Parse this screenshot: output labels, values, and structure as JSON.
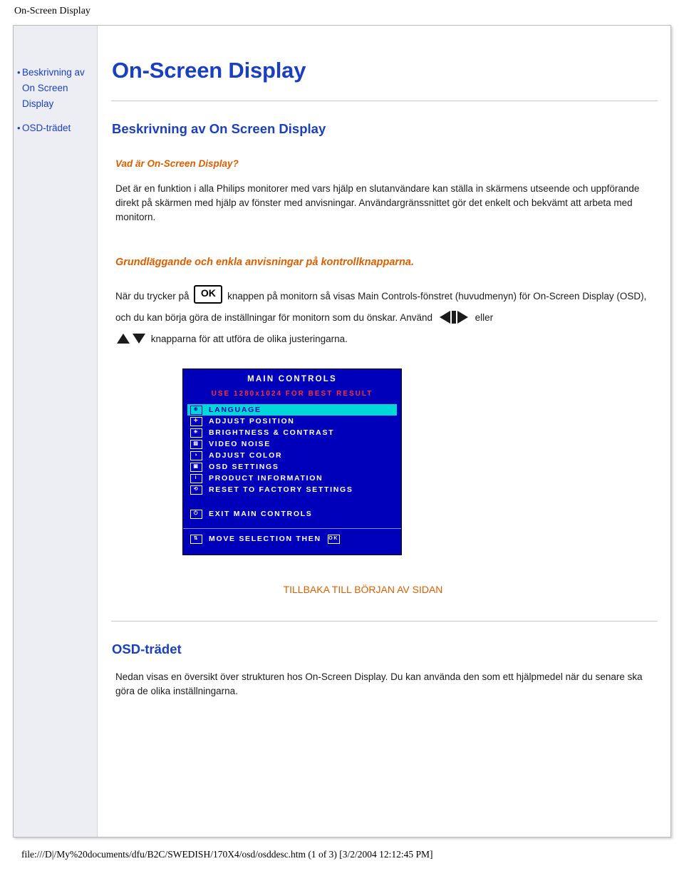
{
  "page": {
    "header_title": "On-Screen Display",
    "footer_path": "file:///D|/My%20documents/dfu/B2C/SWEDISH/170X4/osd/osddesc.htm (1 of 3) [3/2/2004 12:12:45 PM]"
  },
  "sidebar": {
    "items": [
      {
        "label": "Beskrivning av On Screen Display"
      },
      {
        "label": "OSD-trädet"
      }
    ]
  },
  "main": {
    "title": "On-Screen Display",
    "section1_heading": "Beskrivning av On Screen Display",
    "subsection1_heading": "Vad är On-Screen Display?",
    "paragraph1": "Det är en funktion i alla Philips monitorer med vars hjälp en slutanvändare kan ställa in skärmens utseende och uppförande direkt på skärmen med hjälp av fönster med anvisningar. Användargränssnittet gör det enkelt och bekvämt att arbeta med monitorn.",
    "subsection2_heading": "Grundläggande och enkla anvisningar på kontrollknapparna.",
    "instructions_part1": "När du trycker på",
    "ok_button_label": "OK",
    "instructions_part2": "knappen på monitorn så visas Main Controls-fönstret (huvudmenyn) för On-Screen Display (OSD), och du kan börja göra de inställningar för monitorn som du önskar. Använd",
    "instructions_part3": "eller",
    "instructions_part4": "knapparna för att utföra de olika justeringarna.",
    "back_to_top": "TILLBAKA TILL BÖRJAN AV SIDAN",
    "section2_heading": "OSD-trädet",
    "paragraph2": "Nedan visas en översikt över strukturen hos On-Screen Display. Du kan använda den som ett hjälpmedel när du senare ska göra de olika inställningarna."
  },
  "osd_screenshot": {
    "title": "MAIN CONTROLS",
    "subtitle": "USE 1280x1024 FOR BEST RESULT",
    "menu_items": [
      {
        "label": "LANGUAGE",
        "icon": "globe-icon",
        "selected": true
      },
      {
        "label": "ADJUST POSITION",
        "icon": "position-icon",
        "selected": false
      },
      {
        "label": "BRIGHTNESS & CONTRAST",
        "icon": "brightness-icon",
        "selected": false
      },
      {
        "label": "VIDEO NOISE",
        "icon": "video-noise-icon",
        "selected": false
      },
      {
        "label": "ADJUST COLOR",
        "icon": "color-icon",
        "selected": false
      },
      {
        "label": "OSD SETTINGS",
        "icon": "osd-settings-icon",
        "selected": false
      },
      {
        "label": "PRODUCT INFORMATION",
        "icon": "info-icon",
        "selected": false
      },
      {
        "label": "RESET TO FACTORY SETTINGS",
        "icon": "reset-icon",
        "selected": false
      }
    ],
    "exit_label": "EXIT MAIN CONTROLS",
    "footer_label": "MOVE SELECTION THEN",
    "colors": {
      "background": "#0000bb",
      "highlight": "#00d7d7",
      "subtitle_color": "#ff2f2f",
      "text": "#ffffff"
    }
  }
}
